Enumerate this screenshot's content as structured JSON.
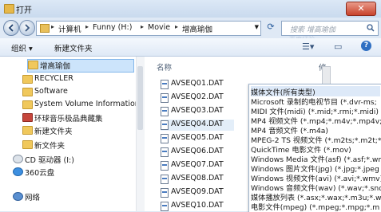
{
  "window": {
    "title": "打开",
    "close_glyph": "✕"
  },
  "nav": {
    "breadcrumbs": [
      "计算机",
      "Funny (H:)",
      "Movie",
      "增高瑜伽"
    ],
    "search_placeholder": "搜索 增高瑜伽",
    "watermark": "百度经验"
  },
  "toolbar": {
    "organize": "组织 ▾",
    "new_folder": "新建文件夹"
  },
  "sidebar": {
    "items": [
      {
        "label": "增高瑜伽",
        "icon": "folder-icon"
      },
      {
        "label": "RECYCLER",
        "icon": "folder-icon"
      },
      {
        "label": "Software",
        "icon": "folder-icon"
      },
      {
        "label": "System Volume Information",
        "icon": "folder-icon"
      },
      {
        "label": "环球音乐极品典藏集",
        "icon": "book-icon"
      },
      {
        "label": "新建文件夹",
        "icon": "folder-icon"
      },
      {
        "label": "新文件夹",
        "icon": "folder-icon"
      },
      {
        "label": "CD 驱动器 (I:)",
        "icon": "cd-drive-icon"
      },
      {
        "label": "360云盘",
        "icon": "cloud-icon"
      },
      {
        "label": "网络",
        "icon": "network-icon"
      }
    ]
  },
  "files": {
    "column_name": "名称",
    "column_other": "修",
    "items": [
      "AVSEQ01.DAT",
      "AVSEQ02.DAT",
      "AVSEQ03.DAT",
      "AVSEQ04.DAT",
      "AVSEQ05.DAT",
      "AVSEQ06.DAT",
      "AVSEQ07.DAT",
      "AVSEQ08.DAT",
      "AVSEQ09.DAT",
      "AVSEQ10.DAT"
    ]
  },
  "filter_dropdown": {
    "items": [
      "媒体文件(所有类型)",
      "Microsoft 录制的电视节目 (*.dvr-ms;",
      "MIDI 文件(midi) (*.mid;*.rmi;*.midi)",
      "MP4 视频文件 (*.mp4;*.m4v;*.mp4v;",
      "MP4 音频文件 (*.m4a)",
      "MPEG-2 TS 视频文件 (*.m2ts;*.m2t;*",
      "QuickTime 电影文件 (*.mov)",
      "Windows Media 文件(asf) (*.asf;*.wm",
      "Windows 图片文件(jpg) (*.jpg;*.jpeg",
      "Windows 视频文件(avi) (*.avi;*.wmv)",
      "Windows 音频文件(wav) (*.wav;*.snd",
      "媒体播放列表 (*.asx;*.wax;*.m3u;*.wp",
      "电影文件(mpeg) (*.mpeg;*.mpg;*.m"
    ]
  }
}
